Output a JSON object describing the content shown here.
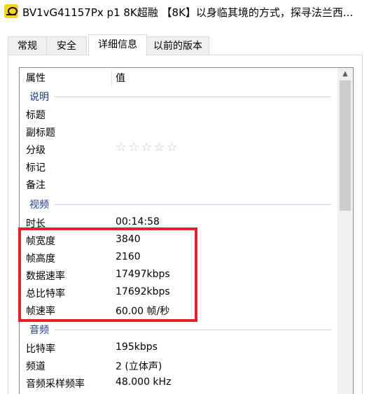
{
  "window": {
    "title": "BV1vG41157Px p1 8K超融 【8K】以身临其境的方式，探寻法兰西...",
    "icon": "player-app-icon"
  },
  "tabs": [
    {
      "label": "常规",
      "active": false
    },
    {
      "label": "安全",
      "active": false
    },
    {
      "label": "详细信息",
      "active": true
    },
    {
      "label": "以前的版本",
      "active": false
    }
  ],
  "list_header": {
    "property": "属性",
    "value": "值"
  },
  "sections": {
    "description": {
      "title": "说明",
      "rows": [
        {
          "label": "标题",
          "value": ""
        },
        {
          "label": "副标题",
          "value": ""
        },
        {
          "label": "分级",
          "value": "",
          "rating": 0,
          "max_rating": 5
        },
        {
          "label": "标记",
          "value": ""
        },
        {
          "label": "备注",
          "value": ""
        }
      ]
    },
    "video": {
      "title": "视频",
      "rows": [
        {
          "label": "时长",
          "value": "00:14:58"
        },
        {
          "label": "帧宽度",
          "value": "3840"
        },
        {
          "label": "帧高度",
          "value": "2160"
        },
        {
          "label": "数据速率",
          "value": "17497kbps"
        },
        {
          "label": "总比特率",
          "value": "17692kbps"
        },
        {
          "label": "帧速率",
          "value": "60.00 帧/秒"
        }
      ]
    },
    "audio": {
      "title": "音频",
      "rows": [
        {
          "label": "比特率",
          "value": "195kbps"
        },
        {
          "label": "频道",
          "value": "2 (立体声)"
        },
        {
          "label": "音频采样频率",
          "value": "48.000 kHz"
        }
      ]
    }
  },
  "stars_glyph": "☆☆☆☆☆",
  "colors": {
    "highlight": "#e81f2b",
    "group_title": "#1e3b8a"
  }
}
